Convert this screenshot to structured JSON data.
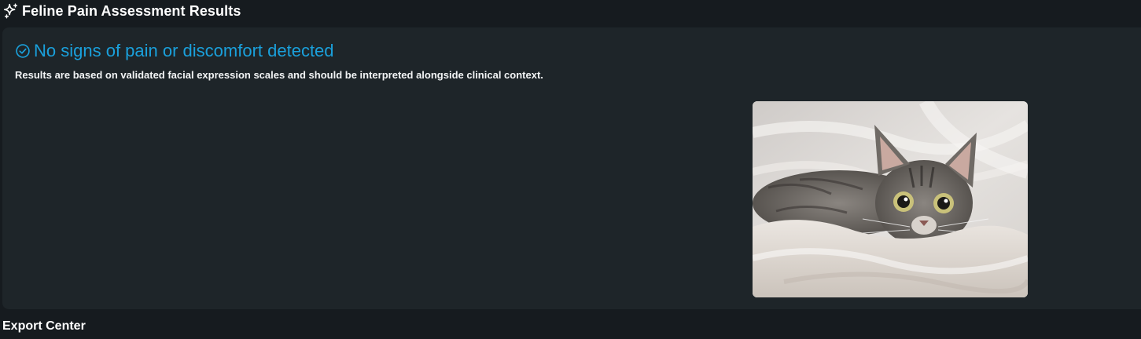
{
  "header": {
    "title": "Feline Pain Assessment Results",
    "icon": "sparkle-icon"
  },
  "result": {
    "status_icon": "check-circle-icon",
    "status_text": "No signs of pain or discomfort detected",
    "status_color": "#1aa0db",
    "disclaimer": "Results are based on validated facial expression scales and should be interpreted alongside clinical context.",
    "image_subject": "tabby kitten lying on white blanket"
  },
  "footer": {
    "export_title": "Export Center"
  },
  "colors": {
    "page_bg": "#161b1f",
    "card_bg": "#1e2529",
    "accent": "#1aa0db",
    "text": "#ffffff"
  }
}
